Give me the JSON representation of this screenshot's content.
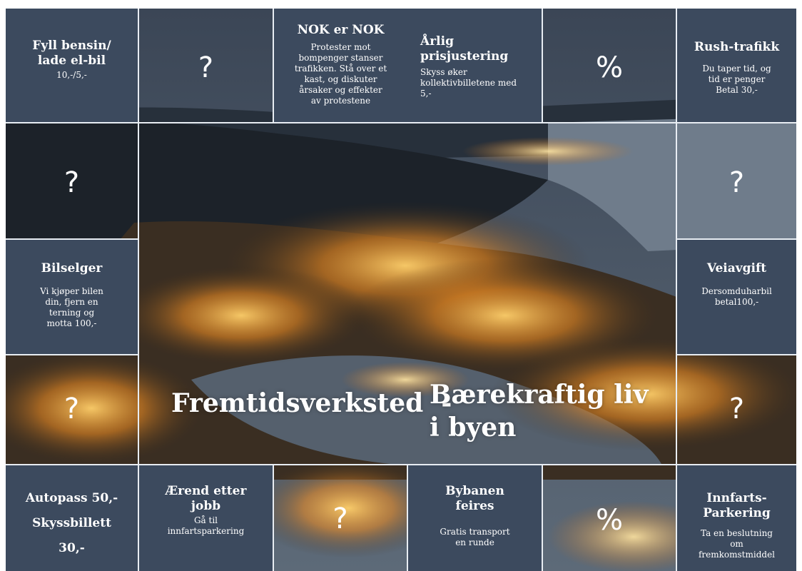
{
  "board": {
    "colors": {
      "card_bg": "#3c4a5e",
      "card_text": "#ffffff",
      "divider": "#e8edf3"
    },
    "center_title": {
      "part1": "Fremtidsverksted  -",
      "part2": "Bærekraftig liv",
      "part3": "i byen"
    },
    "top_row": [
      {
        "title": "Fyll bensin/ lade el-bil",
        "text": "10,-/5,-"
      },
      {
        "mark": "?",
        "icon": "question-mark"
      },
      {
        "title": "NOK er NOK",
        "text": "Protester mot bompenger stanser trafikken. Stå over et kast, og diskuter årsaker og effekter av protestene"
      },
      {
        "title": "Årlig prisjustering",
        "text": "Skyss øker kollektivbilletene med 5,-"
      },
      {
        "mark": "%",
        "icon": "percent-sign"
      },
      {
        "title": "Rush-trafikk",
        "text": "Du taper tid, og tid er penger Betal 30,-"
      }
    ],
    "left_column": [
      {
        "mark": "?",
        "icon": "question-mark"
      },
      {
        "title": "Bilselger",
        "text": "Vi kjøper bilen din, fjern en terning og motta 100,-"
      },
      {
        "mark": "?",
        "icon": "question-mark"
      }
    ],
    "right_column": [
      {
        "mark": "?",
        "icon": "question-mark"
      },
      {
        "title": "Veiavgift",
        "text": "Dersomduharbil betal100,-"
      },
      {
        "mark": "?",
        "icon": "question-mark"
      }
    ],
    "bottom_row": [
      {
        "lines": [
          "Autopass 50,-",
          "Skyssbillett",
          "30,-"
        ]
      },
      {
        "title": "Ærend etter jobb",
        "text": "Gå til innfartsparkering"
      },
      {
        "mark": "?",
        "icon": "question-mark"
      },
      {
        "title": "Bybanen feires",
        "text": "Gratis transport en runde"
      },
      {
        "mark": "%",
        "icon": "percent-sign"
      },
      {
        "title": "Innfarts-Parkering",
        "text": "Ta en beslutning om fremkomstmiddel"
      }
    ]
  }
}
